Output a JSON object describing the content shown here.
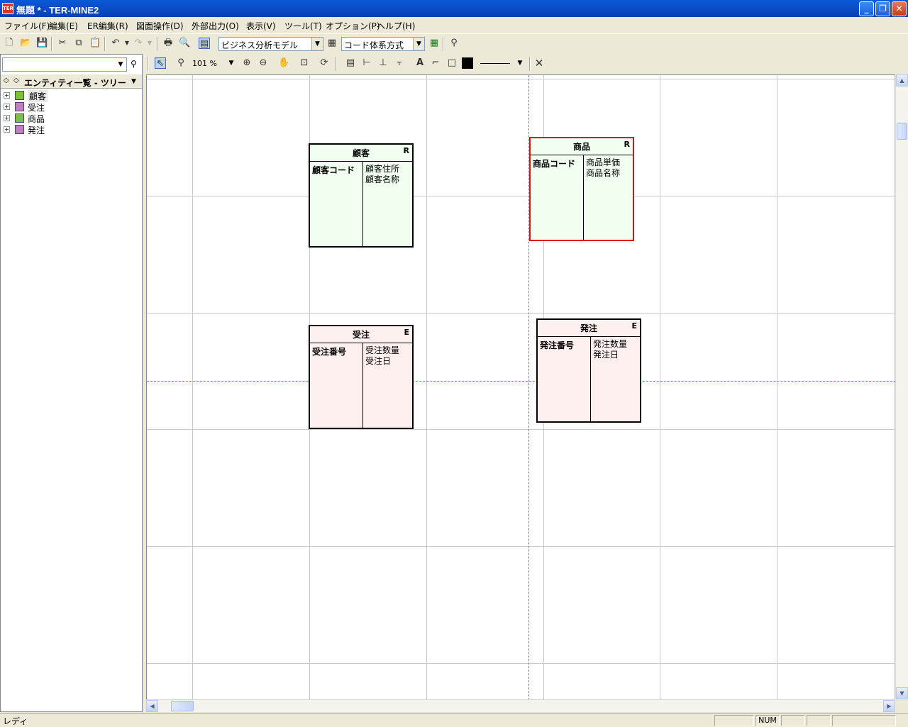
{
  "window": {
    "title": "無題 * - TER-MINE2",
    "app_icon_text": "TER",
    "minimize": "_",
    "restore": "❐",
    "close": "✕"
  },
  "menu": [
    "ファイル(F)",
    "編集(E)",
    "ER編集(R)",
    "図面操作(D)",
    "外部出力(O)",
    "表示(V)",
    "ツール(T)",
    "オプション(P)",
    "ヘルプ(H)"
  ],
  "toolbar": {
    "model_select": "ビジネス分析モデル",
    "code_select": "コード体系方式"
  },
  "diagram_toolbar": {
    "zoom_value": "101 %"
  },
  "left_panel": {
    "combo_value": "",
    "tree_title": "エンティティ一覧 - ツリー",
    "tree_items": [
      {
        "label": "顧客",
        "color": "#7ac142"
      },
      {
        "label": "受注",
        "color": "#c080c0"
      },
      {
        "label": "商品",
        "color": "#7ac142"
      },
      {
        "label": "発注",
        "color": "#c080c0"
      }
    ]
  },
  "entities": [
    {
      "name": "顧客",
      "type": "R",
      "key": "顧客コード",
      "attrs": [
        "顧客住所",
        "顧客名称"
      ]
    },
    {
      "name": "商品",
      "type": "R",
      "key": "商品コード",
      "attrs": [
        "商品単価",
        "商品名称"
      ]
    },
    {
      "name": "受注",
      "type": "E",
      "key": "受注番号",
      "attrs": [
        "受注数量",
        "受注日"
      ]
    },
    {
      "name": "発注",
      "type": "E",
      "key": "発注番号",
      "attrs": [
        "発注数量",
        "発注日"
      ]
    }
  ],
  "status": {
    "text": "レディ",
    "num": "NUM"
  },
  "colors": {
    "resource_bg": "#f0fff0",
    "event_bg": "#fff0f0",
    "selected_border": "#e01010",
    "guide_line": "#1ec81e"
  }
}
